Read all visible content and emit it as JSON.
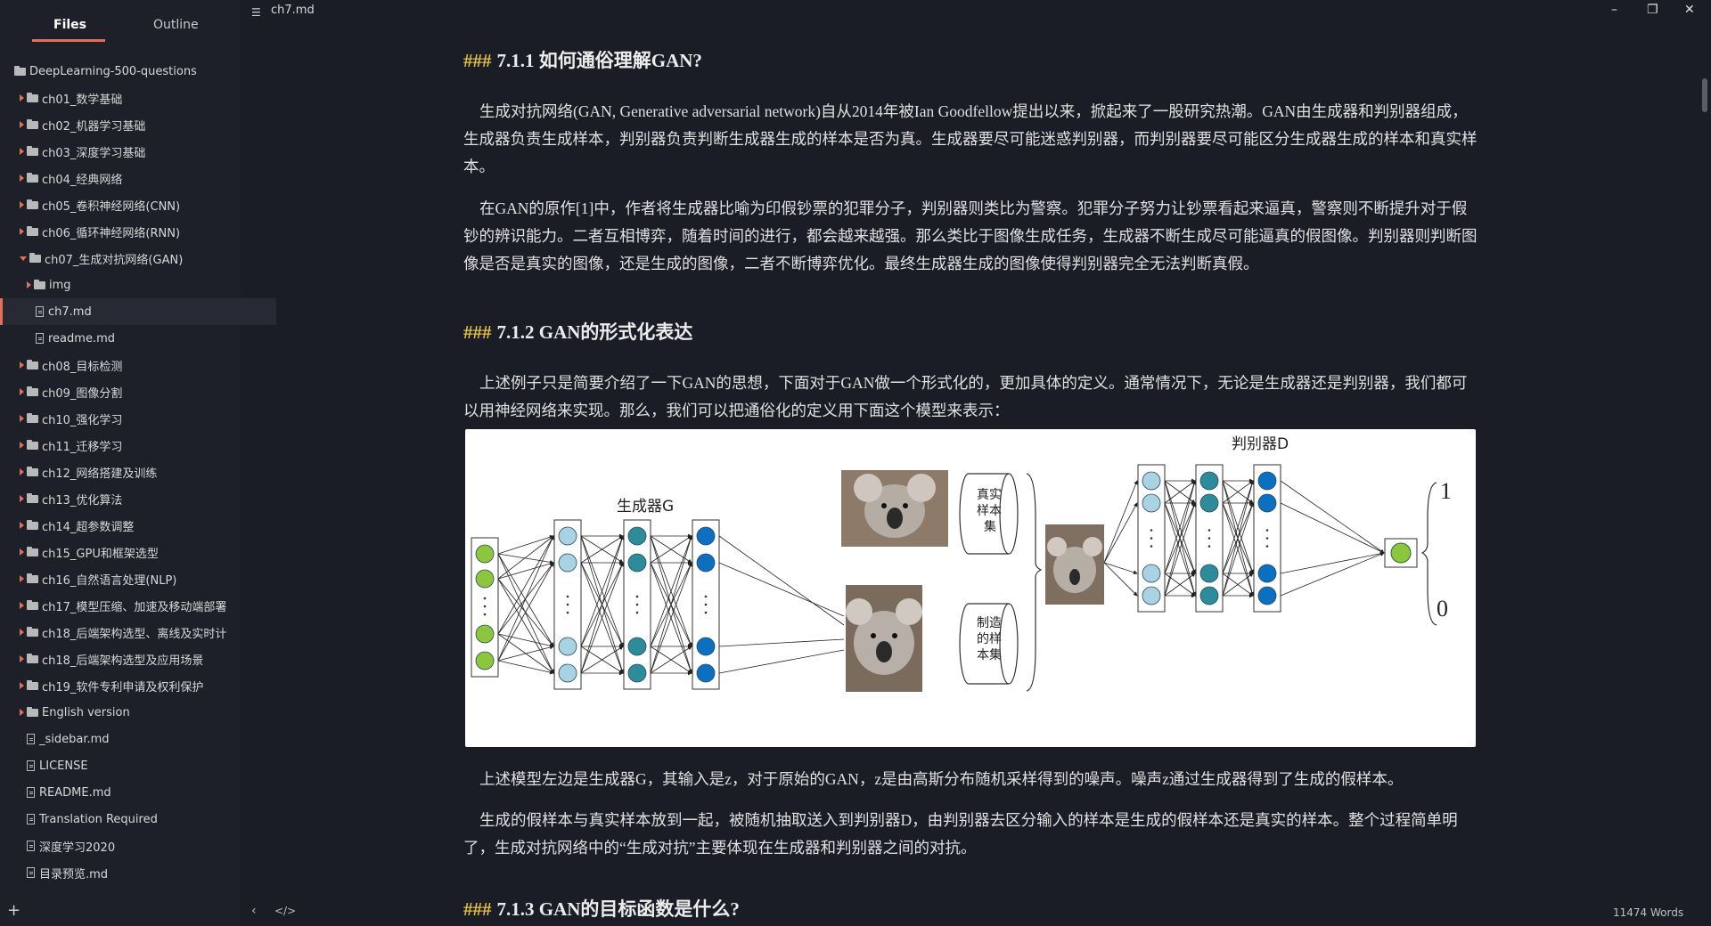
{
  "window": {
    "title": "ch7.md",
    "minimize": "–",
    "maximize": "❐",
    "close": "✕"
  },
  "sidebar": {
    "tabs": [
      {
        "label": "Files",
        "active": true
      },
      {
        "label": "Outline",
        "active": false
      }
    ],
    "root": "DeepLearning-500-questions",
    "items": [
      {
        "label": "ch01_数学基础",
        "type": "folder",
        "expanded": false
      },
      {
        "label": "ch02_机器学习基础",
        "type": "folder",
        "expanded": false
      },
      {
        "label": "ch03_深度学习基础",
        "type": "folder",
        "expanded": false
      },
      {
        "label": "ch04_经典网络",
        "type": "folder",
        "expanded": false
      },
      {
        "label": "ch05_卷积神经网络(CNN)",
        "type": "folder",
        "expanded": false
      },
      {
        "label": "ch06_循环神经网络(RNN)",
        "type": "folder",
        "expanded": false
      },
      {
        "label": "ch07_生成对抗网络(GAN)",
        "type": "folder",
        "expanded": true
      },
      {
        "label": "img",
        "type": "folder",
        "expanded": false
      },
      {
        "label": "ch7.md",
        "type": "file",
        "active": true
      },
      {
        "label": "readme.md",
        "type": "file"
      },
      {
        "label": "ch08_目标检测",
        "type": "folder",
        "expanded": false
      },
      {
        "label": "ch09_图像分割",
        "type": "folder",
        "expanded": false
      },
      {
        "label": "ch10_强化学习",
        "type": "folder",
        "expanded": false
      },
      {
        "label": "ch11_迁移学习",
        "type": "folder",
        "expanded": false
      },
      {
        "label": "ch12_网络搭建及训练",
        "type": "folder",
        "expanded": false
      },
      {
        "label": "ch13_优化算法",
        "type": "folder",
        "expanded": false
      },
      {
        "label": "ch14_超参数调整",
        "type": "folder",
        "expanded": false
      },
      {
        "label": "ch15_GPU和框架选型",
        "type": "folder",
        "expanded": false
      },
      {
        "label": "ch16_自然语言处理(NLP)",
        "type": "folder",
        "expanded": false
      },
      {
        "label": "ch17_模型压缩、加速及移动端部署",
        "type": "folder",
        "expanded": false
      },
      {
        "label": "ch18_后端架构选型、离线及实时计",
        "type": "folder",
        "expanded": false
      },
      {
        "label": "ch18_后端架构选型及应用场景",
        "type": "folder",
        "expanded": false
      },
      {
        "label": "ch19_软件专利申请及权利保护",
        "type": "folder",
        "expanded": false
      },
      {
        "label": "English version",
        "type": "folder",
        "expanded": false
      },
      {
        "label": "_sidebar.md",
        "type": "file"
      },
      {
        "label": "LICENSE",
        "type": "file"
      },
      {
        "label": "README.md",
        "type": "file"
      },
      {
        "label": "Translation Required",
        "type": "file"
      },
      {
        "label": "深度学习2020",
        "type": "file"
      },
      {
        "label": "目录预览.md",
        "type": "file"
      }
    ],
    "add_button": "+"
  },
  "document": {
    "h1": {
      "hash": "###",
      "text": "7.1.1 如何通俗理解GAN?"
    },
    "p1": "生成对抗网络(GAN, Generative adversarial network)自从2014年被Ian Goodfellow提出以来，掀起来了一股研究热潮。GAN由生成器和判别器组成，生成器负责生成样本，判别器负责判断生成器生成的样本是否为真。生成器要尽可能迷惑判别器，而判别器要尽可能区分生成器生成的样本和真实样本。",
    "p2": "在GAN的原作[1]中，作者将生成器比喻为印假钞票的犯罪分子，判别器则类比为警察。犯罪分子努力让钞票看起来逼真，警察则不断提升对于假钞的辨识能力。二者互相博弈，随着时间的进行，都会越来越强。那么类比于图像生成任务，生成器不断生成尽可能逼真的假图像。判别器则判断图像是否是真实的图像，还是生成的图像，二者不断博弈优化。最终生成器生成的图像使得判别器完全无法判断真假。",
    "h2": {
      "hash": "###",
      "text": "7.1.2 GAN的形式化表达"
    },
    "p3": "上述例子只是简要介绍了一下GAN的思想，下面对于GAN做一个形式化的，更加具体的定义。通常情况下，无论是生成器还是判别器，我们都可以用神经网络来实现。那么，我们可以把通俗化的定义用下面这个模型来表示：",
    "figure": {
      "generator_label": "生成器G",
      "discriminator_label": "判别器D",
      "real_set": "真实样本集",
      "fake_set": "制造的样本集",
      "output_one": "1",
      "output_zero": "0"
    },
    "p4": "上述模型左边是生成器G，其输入是z，对于原始的GAN，z是由高斯分布随机采样得到的噪声。噪声z通过生成器得到了生成的假样本。",
    "p5": "生成的假样本与真实样本放到一起，被随机抽取送入到判别器D，由判别器去区分输入的样本是生成的假样本还是真实的样本。整个过程简单明了，生成对抗网络中的“生成对抗”主要体现在生成器和判别器之间的对抗。",
    "h3": {
      "hash": "###",
      "text": "7.1.3 GAN的目标函数是什么?"
    }
  },
  "statusbar": {
    "toggle_sidebar": "‹",
    "source_mode": "</>",
    "word_count": "11474 Words"
  },
  "colors": {
    "accent": "#e26e5b",
    "hash": "#e5c24a",
    "node_green": "#8cc63f",
    "node_light": "#a9d3e3",
    "node_teal": "#2e8b9a",
    "node_blue": "#0c6fbf"
  }
}
